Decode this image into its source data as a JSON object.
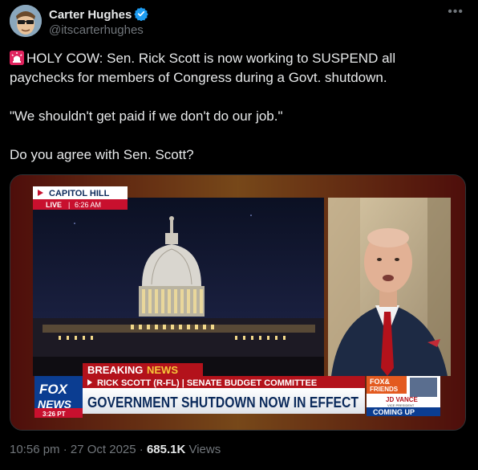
{
  "author": {
    "name": "Carter Hughes",
    "handle": "@itscarterhughes",
    "verified": true
  },
  "post": {
    "line1": "HOLY COW: Sen. Rick Scott is now working to SUSPEND all paychecks for members of Congress during a Govt. shutdown.",
    "line2": "\"We shouldn't get paid if we don't do our job.\"",
    "line3": "Do you agree with Sen. Scott?"
  },
  "media": {
    "location_label": "CAPITOL HILL",
    "live_label": "LIVE",
    "live_time": "6:26 AM",
    "breaking_label": "BREAKING",
    "news_label": "NEWS",
    "subtitle": "RICK SCOTT (R-FL) | SENATE BUDGET COMMITTEE",
    "headline": "GOVERNMENT SHUTDOWN NOW IN EFFECT",
    "logo_line1": "FOX",
    "logo_line2": "NEWS",
    "logo_time": "3:26 PT",
    "promo_line1": "FOX&",
    "promo_line2": "FRIENDS",
    "promo_name": "JD VANCE",
    "promo_title": "VICE PRESIDENT",
    "promo_cta": "COMING UP"
  },
  "meta": {
    "time": "10:56 pm · 27 Oct 2025 · ",
    "views_count": "685.1K",
    "views_label": " Views"
  },
  "colors": {
    "background": "#000000",
    "verified_blue": "#1d9bf0",
    "fox_red": "#c8102e",
    "fox_blue": "#0b3d91"
  }
}
